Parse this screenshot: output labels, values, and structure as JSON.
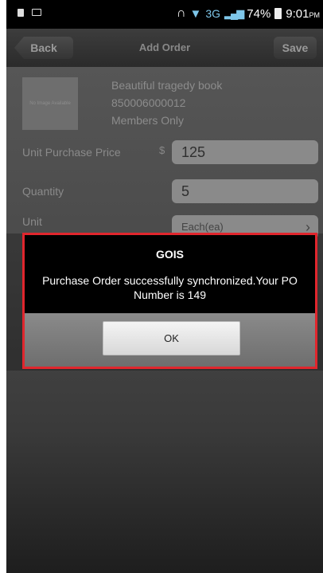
{
  "status_bar": {
    "network": "3G",
    "battery": "74%",
    "time": "9:01",
    "ampm": "PM"
  },
  "nav": {
    "back_label": "Back",
    "title": "Add Order",
    "save_label": "Save"
  },
  "product": {
    "thumbnail_text": "No Image Available",
    "name": "Beautiful tragedy book",
    "code": "850006000012",
    "note": "Members Only"
  },
  "form": {
    "unit_price_label": "Unit Purchase Price",
    "currency_symbol": "$",
    "unit_price_value": "125",
    "quantity_label": "Quantity",
    "quantity_value": "5",
    "unit_label": "Unit",
    "unit_value": "Each(ea)"
  },
  "dialog": {
    "title": "GOIS",
    "message": "Purchase Order successfully synchronized.Your PO Number is 149",
    "ok_label": "OK"
  },
  "colors": {
    "highlight": "#e0262d",
    "status_accent": "#7ec7ea"
  }
}
